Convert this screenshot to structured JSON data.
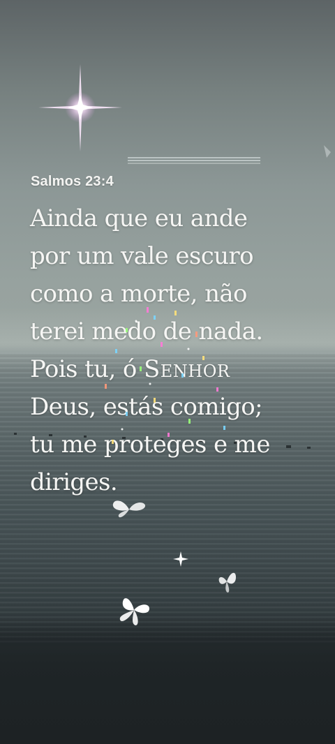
{
  "story": {
    "reference": "Salmos 23:4",
    "verse_lines": [
      "Ainda que eu ande",
      "por um vale escuro",
      "como a morte, não",
      "terei medo de nada.",
      "Pois tu, ó",
      "Deus, estás comigo;",
      "tu me proteges e me",
      "diriges."
    ],
    "lord_title": "Senhor"
  },
  "decorations": {
    "sparkle_icon": "four-point-star-sparkle",
    "butterfly_icon": "white-butterfly",
    "glitter_icon": "rainbow-glitter",
    "colors": {
      "text": "#f6f6f4",
      "sparkle": "#f3d9f4",
      "butterfly": "#ffffff"
    }
  }
}
